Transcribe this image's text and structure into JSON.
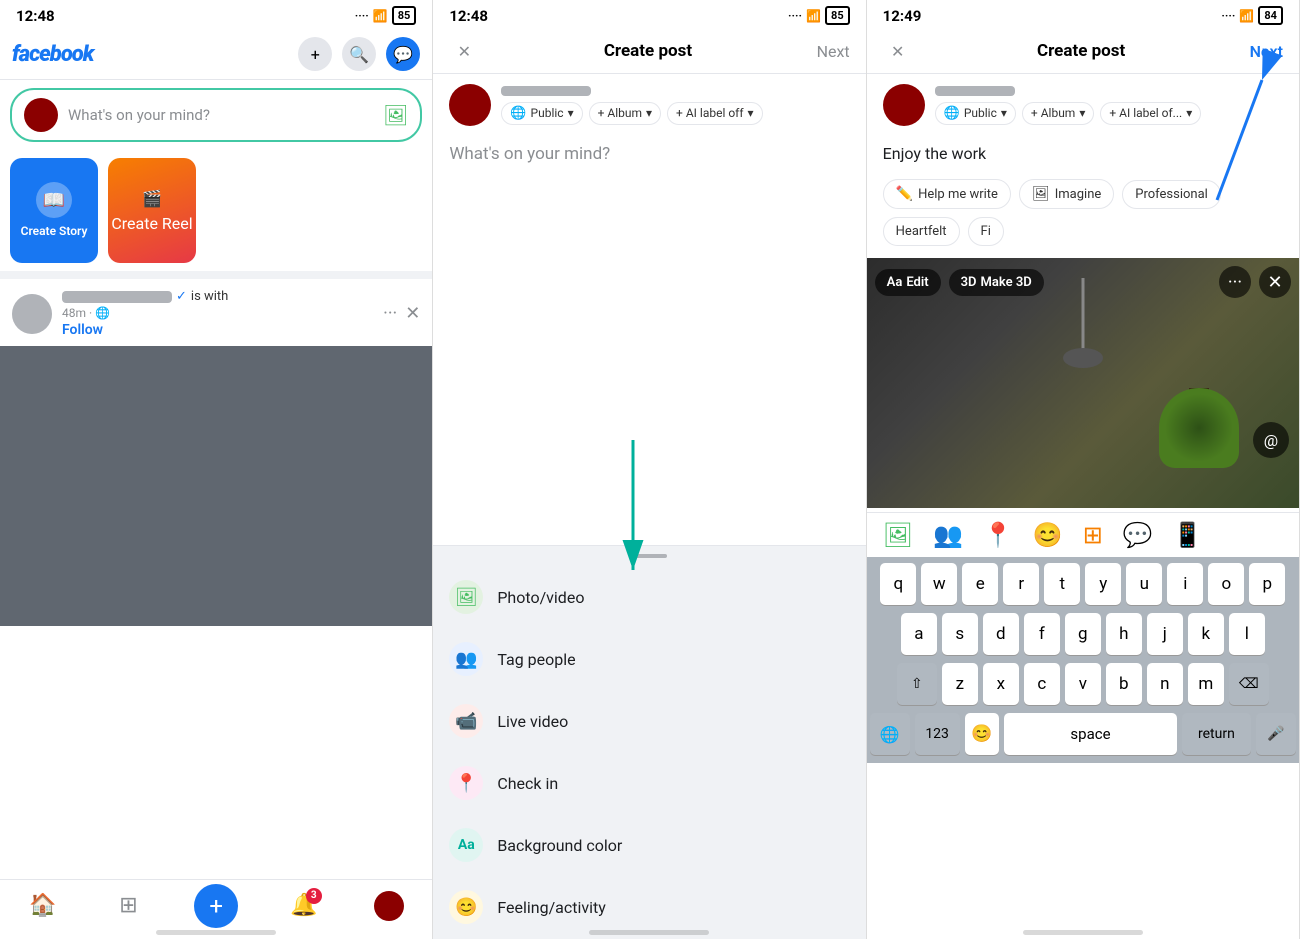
{
  "screen1": {
    "time": "12:48",
    "battery": "85",
    "logo": "facebook",
    "post_placeholder": "What's on your mind?",
    "create_story_label": "Create Story",
    "create_reel_label": "Create Reel",
    "feed": {
      "is_with": "is with",
      "follow": "Follow",
      "time_ago": "48m",
      "privacy": "🌐"
    },
    "nav": {
      "home": "🏠",
      "grid": "▦",
      "add": "+",
      "bell": "🔔",
      "avatar": "👤",
      "badge": "3"
    }
  },
  "screen2": {
    "time": "12:48",
    "battery": "85",
    "header_title": "Create post",
    "next_label": "Next",
    "close_icon": "✕",
    "post_placeholder": "What's on your mind?",
    "chips": [
      {
        "icon": "🌐",
        "label": "Public"
      },
      {
        "icon": "+",
        "label": "Album"
      },
      {
        "icon": "+",
        "label": "AI label off"
      }
    ],
    "options": [
      {
        "label": "Photo/video",
        "icon": "🖼",
        "color": "green"
      },
      {
        "label": "Tag people",
        "icon": "👥",
        "color": "blue"
      },
      {
        "label": "Live video",
        "icon": "📹",
        "color": "red"
      },
      {
        "label": "Check in",
        "icon": "📍",
        "color": "pink"
      },
      {
        "label": "Background color",
        "icon": "Aa",
        "color": "teal"
      },
      {
        "label": "Feeling/activity",
        "icon": "😊",
        "color": "yellow"
      }
    ]
  },
  "screen3": {
    "time": "12:49",
    "battery": "84",
    "header_title": "Create post",
    "next_label": "Next",
    "close_icon": "✕",
    "post_text": "Enjoy the work",
    "chips": [
      {
        "icon": "🌐",
        "label": "Public"
      },
      {
        "icon": "+",
        "label": "Album"
      },
      {
        "icon": "+",
        "label": "AI label of..."
      }
    ],
    "ai_tools": [
      {
        "icon": "✏️",
        "label": "Help me write"
      },
      {
        "icon": "🖼",
        "label": "Imagine"
      },
      {
        "label": "Professional"
      },
      {
        "label": "Heartfelt"
      },
      {
        "label": "Fi"
      }
    ],
    "editor": {
      "edit_label": "Aa Edit",
      "make3d_label": "3D Make 3D"
    },
    "keyboard": {
      "rows": [
        [
          "q",
          "w",
          "e",
          "r",
          "t",
          "y",
          "u",
          "i",
          "o",
          "p"
        ],
        [
          "a",
          "s",
          "d",
          "f",
          "g",
          "h",
          "j",
          "k",
          "l"
        ],
        [
          "z",
          "x",
          "c",
          "v",
          "b",
          "n",
          "m"
        ],
        [
          "123",
          "😊",
          "space",
          "return"
        ]
      ],
      "space_label": "space",
      "return_label": "return",
      "num_label": "123"
    }
  }
}
